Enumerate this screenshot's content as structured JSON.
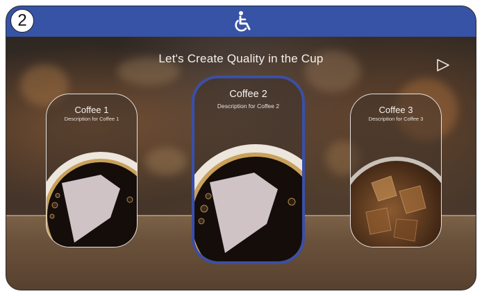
{
  "header": {
    "step_number": "2",
    "icon": "wheelchair-accessibility-icon",
    "background_color": "#3753a5"
  },
  "main": {
    "title": "Let's Create Quality in the Cup",
    "next_icon": "play-triangle-outline-icon"
  },
  "cards": [
    {
      "name": "Coffee 1",
      "description": "Description for Coffee 1",
      "image": "black-coffee-cup-topdown",
      "selected": false
    },
    {
      "name": "Coffee 2",
      "description": "Description for Coffee 2",
      "image": "black-coffee-cup-topdown",
      "selected": true
    },
    {
      "name": "Coffee 3",
      "description": "Description for Coffee 3",
      "image": "iced-coffee-glass-topdown",
      "selected": false
    }
  ],
  "colors": {
    "selected_border": "#3b4fa8",
    "text": "#f4f1ee"
  }
}
